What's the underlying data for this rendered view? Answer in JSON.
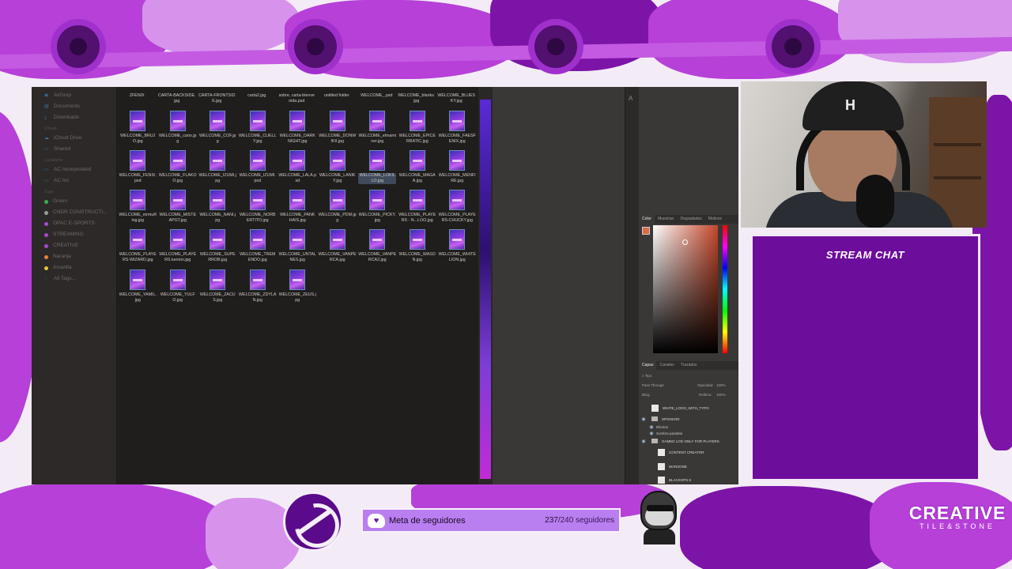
{
  "finder": {
    "sidebar": [
      {
        "type": "item",
        "label": "AirDrop",
        "icon": "airdrop-icon"
      },
      {
        "type": "item",
        "label": "Documents",
        "icon": "document-icon"
      },
      {
        "type": "item",
        "label": "Downloads",
        "icon": "download-icon"
      },
      {
        "type": "header",
        "label": "iCloud"
      },
      {
        "type": "item",
        "label": "iCloud Drive",
        "icon": "cloud-icon"
      },
      {
        "type": "item",
        "label": "Shared",
        "icon": "shared-folder-icon"
      },
      {
        "type": "header",
        "label": "Locations"
      },
      {
        "type": "item",
        "label": "AC Incorporated",
        "icon": "drive-icon"
      },
      {
        "type": "item",
        "label": "AC Inc",
        "icon": "drive-icon"
      },
      {
        "type": "header",
        "label": "Tags"
      },
      {
        "type": "tag",
        "label": "Green",
        "color": "#3cae4a"
      },
      {
        "type": "tag",
        "label": "CNDR CONSTRUCTI...",
        "color": "#9c9c9c"
      },
      {
        "type": "tag",
        "label": "OPAC E-SPORTS",
        "color": "#a44ad0"
      },
      {
        "type": "tag",
        "label": "STREAMING",
        "color": "#a44ad0"
      },
      {
        "type": "tag",
        "label": "CREATIVE",
        "color": "#a44ad0"
      },
      {
        "type": "tag",
        "label": "Naranja",
        "color": "#e8823a"
      },
      {
        "type": "tag",
        "label": "Amarilla",
        "color": "#e8c53a"
      },
      {
        "type": "item",
        "label": "All Tags...",
        "icon": "tags-icon"
      }
    ],
    "top_row": [
      "ZFENIX",
      "CARTA-BACKSIDE.jpg",
      "CARTA-FRONTSIDE.jpg",
      "carta2.jpg",
      "sobre, carta-bienvenida.psd",
      "untitled folder",
      "WELCOME_.psd",
      "WELCOME_blanks.jpg",
      "WELCOME_BLUESKY.jpg"
    ],
    "rows": [
      [
        "WELCOME_BRUJO.jpg",
        "WELCOME_cano.jpg",
        "WELCOME_COF.jpg",
        "WELCOME_CUELLY.jpg",
        "WELCOME_DARKNIGHT.jpg",
        "WELCOME_DONWIKII.jpg",
        "WELCOME_elmaminer.jpg",
        "WELCOME_EPICERRATIC.jpg",
        "WELCOME_FAESFENIX.jpg"
      ],
      [
        "WELCOME_FENIX.psd",
        "WELCOME_FLAKOO.jpg",
        "WELCOME_IZUMI.jpg",
        "WELCOME_IZUMI.psd",
        "WELCOME_LALA.psd",
        "WELCOME_LANIKY.jpg",
        "WELCOME_LOKILLO.jpg",
        "WELCOME_MAGAA.jpg",
        "WELCOME_MENFIRE.jpg"
      ],
      [
        "WELCOME_mrmuRing.jpg",
        "WELCOME_MISTEAPGT.jpg",
        "WELCOME_NANI.jpg",
        "WELCOME_NORBERTITO.jpg",
        "WELCOME_PANKHAIS.jpg",
        "WELCOME_PDM.jpg",
        "WELCOME_PICKY.jpg",
        "WELCOME_PLAYERS - N...LOO.jpg",
        "WELCOME_PLAYERS-CHUCKY.jpg"
      ],
      [
        "WELCOME_PLAYERS-WIZARD.jpg",
        "WELCOME_PLAYERS.kenton.jpg",
        "WELCOME_SUPERROB.jpg",
        "WELCOME_TREMENDO.jpg",
        "WELCOME_UNTALNES.jpg",
        "WELCOME_VANPERCA.jpg",
        "WELCOME_VANPERCA2.jpg",
        "WELCOME_WASON.jpg",
        "WELCOME_WHITELION.jpg"
      ],
      [
        "WELCOME_YAMIL.jpg",
        "WELCOME_YULFO.jpg",
        "WELCOME_ZACUS.jpg",
        "WELCOME_ZDYLAN.jpg",
        "WELCOME_ZEUS.jpg"
      ]
    ],
    "selected_file": "WELCOME_LOKILLO.jpg"
  },
  "photoshop": {
    "color_tabs": [
      "Color",
      "Muestras",
      "Degradados",
      "Motivos"
    ],
    "picker_color": "#c4462a",
    "layer_tabs": [
      "Capas",
      "Canales",
      "Trazados"
    ],
    "filter_label": "Tipo",
    "blend_mode": "Pass Through",
    "opacity_label": "Opacidad:",
    "opacity_value": "100%",
    "lock_label": "Bloq.:",
    "fill_label": "Relleno:",
    "fill_value": "100%",
    "layers": [
      {
        "name": "WHITE_LOGO_WITH_TYPO",
        "kind": "image"
      },
      {
        "name": "SPONSOR",
        "kind": "folder"
      },
      {
        "name": "Efectos",
        "kind": "effect"
      },
      {
        "name": "Sombra paralela",
        "kind": "effect"
      },
      {
        "name": "GAMED LOG ONLY FOR PLAYERS",
        "kind": "folder"
      },
      {
        "name": "CONTENT CREATOR",
        "kind": "image"
      },
      {
        "name": "WARZONE",
        "kind": "image"
      },
      {
        "name": "BLACKOPS 6",
        "kind": "image"
      }
    ]
  },
  "chat": {
    "title": "STREAM CHAT"
  },
  "goal": {
    "label": "Meta de seguidores",
    "current": "237",
    "total": "/240 seguidores"
  },
  "brand": {
    "main": "CREATIVE",
    "sub": "TILE&STONE"
  },
  "colors": {
    "accent": "#b640d8",
    "chat_bg": "#6d0d9b",
    "goal_bg": "#b97ef0"
  }
}
